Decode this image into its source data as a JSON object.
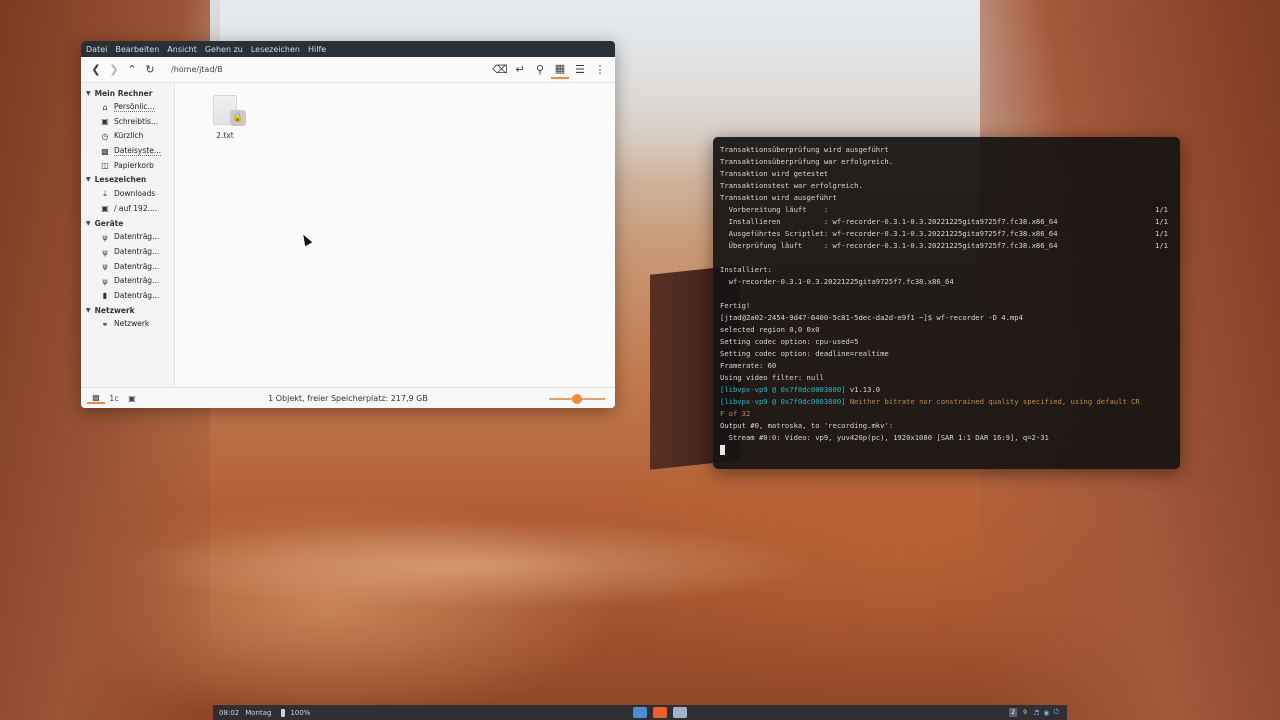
{
  "file_manager": {
    "menu": [
      "Datei",
      "Bearbeiten",
      "Ansicht",
      "Gehen zu",
      "Lesezeichen",
      "Hilfe"
    ],
    "path": "/home/jtad/B",
    "sidebar": {
      "sections": [
        {
          "title": "Mein Rechner",
          "items": [
            {
              "label": "Persönlic...",
              "icon": "home-icon"
            },
            {
              "label": "Schreibtis...",
              "icon": "folder-icon"
            },
            {
              "label": "Kürzlich",
              "icon": "clock-icon"
            },
            {
              "label": "Dateisyste...",
              "icon": "drive-icon"
            },
            {
              "label": "Papierkorb",
              "icon": "trash-icon"
            }
          ]
        },
        {
          "title": "Lesezeichen",
          "items": [
            {
              "label": "Downloads",
              "icon": "download-icon"
            },
            {
              "label": "/ auf 192....",
              "icon": "network-folder-icon"
            }
          ]
        },
        {
          "title": "Geräte",
          "items": [
            {
              "label": "Datenträg...",
              "icon": "usb-icon"
            },
            {
              "label": "Datenträg...",
              "icon": "usb-icon"
            },
            {
              "label": "Datenträg...",
              "icon": "usb-icon"
            },
            {
              "label": "Datenträg...",
              "icon": "usb-icon"
            },
            {
              "label": "Datenträg...",
              "icon": "drive-icon"
            }
          ]
        },
        {
          "title": "Netzwerk",
          "items": [
            {
              "label": "Netzwerk",
              "icon": "network-icon"
            }
          ]
        }
      ]
    },
    "files": [
      {
        "name": "2.txt",
        "icon": "locked-text-file-icon"
      }
    ],
    "status": "1 Objekt, freier Speicherplatz: 217,9 GB",
    "zoom_fraction": 0.5,
    "accent_color": "#f08c3c"
  },
  "terminal": {
    "lines": [
      {
        "text": "Transaktionsüberprüfung wird ausgeführt"
      },
      {
        "text": "Transaktionsüberprüfung war erfolgreich."
      },
      {
        "text": "Transaktion wird getestet"
      },
      {
        "text": "Transaktionstest war erfolgreich."
      },
      {
        "text": "Transaktion wird ausgeführt"
      },
      {
        "text": "  Vorbereitung läuft    :",
        "right": "1/1"
      },
      {
        "text": "  Installieren          : wf-recorder-0.3.1-0.3.20221225gita9725f7.fc38.x86_64",
        "right": "1/1"
      },
      {
        "text": "  Ausgeführtes Scriptlet: wf-recorder-0.3.1-0.3.20221225gita9725f7.fc38.x86_64",
        "right": "1/1"
      },
      {
        "text": "  Überprüfung läuft     : wf-recorder-0.3.1-0.3.20221225gita9725f7.fc38.x86_64",
        "right": "1/1"
      },
      {
        "text": ""
      },
      {
        "text": "Installiert:"
      },
      {
        "text": "  wf-recorder-0.3.1-0.3.20221225gita9725f7.fc38.x86_64"
      },
      {
        "text": ""
      },
      {
        "text": "Fertig!"
      },
      {
        "text": "[jtad@2a02-2454-9d47-6400-5c81-5dec-da2d-e9f1 ~]$ wf-recorder -D 4.mp4"
      },
      {
        "text": "selected region 0,0 0x0"
      },
      {
        "text": "Setting codec option: cpu-used=5"
      },
      {
        "text": "Setting codec option: deadline=realtime"
      },
      {
        "text": "Framerate: 60"
      },
      {
        "text": "Using video filter: null"
      },
      {
        "prefix": "[libvpx-vp9 @ 0x7f0dc0003800]",
        "text": " v1.13.0"
      },
      {
        "prefix": "[libvpx-vp9 @ 0x7f0dc0003800]",
        "warn": " Neither bitrate nor constrained quality specified, using default CR"
      },
      {
        "warn": "F of 32"
      },
      {
        "text": "Output #0, matroska, to 'recording.mkv':"
      },
      {
        "text": "  Stream #0:0: Video: vp9, yuv420p(pc), 1920x1080 [SAR 1:1 DAR 16:9], q=2-31"
      }
    ],
    "prefix_color": "#28b5c9",
    "warn_color": "#b68a4d"
  },
  "taskbar": {
    "clock": "08:02",
    "day": "Montag",
    "battery": "100%",
    "workspaces": [
      "2",
      "9"
    ]
  }
}
